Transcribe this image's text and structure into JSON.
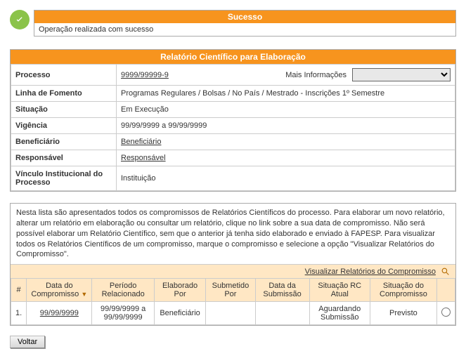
{
  "success": {
    "title": "Sucesso",
    "message": "Operação realizada com sucesso"
  },
  "report_panel": {
    "title": "Relatório Científico para Elaboração",
    "rows": {
      "processo_label": "Processo",
      "processo_value": "9999/99999-9",
      "mais_info_label": "Mais Informações",
      "linha_label": "Linha de Fomento",
      "linha_value": "Programas Regulares / Bolsas / No País / Mestrado - Inscrições 1º Semestre",
      "situacao_label": "Situação",
      "situacao_value": "Em Execução",
      "vigencia_label": "Vigência",
      "vigencia_value": "99/99/9999 a 99/99/9999",
      "beneficiario_label": "Beneficiário",
      "beneficiario_value": "Beneficiário",
      "responsavel_label": "Responsável",
      "responsavel_value": "Responsável",
      "vinculo_label": "Vínculo Institucional do Processo",
      "vinculo_value": "Instituição"
    }
  },
  "list": {
    "description": "Nesta lista são apresentados todos os compromissos de Relatórios Científicos do processo. Para elaborar um novo relatório, alterar um relatório em elaboração ou consultar um relatório, clique no link sobre a sua data de compromisso. Não será possível elaborar um Relatório Científico, sem que o anterior já tenha sido elaborado e enviado à FAPESP. Para visualizar todos os Relatórios Científicos de um compromisso, marque o compromisso e selecione a opção \"Visualizar Relatórios do Compromisso\".",
    "viz_link": "Visualizar Relatórios do Compromisso",
    "columns": {
      "num": "#",
      "data_compromisso": "Data do Compromisso",
      "periodo": "Período Relacionado",
      "elaborado": "Elaborado Por",
      "submetido": "Submetido Por",
      "data_submissao": "Data da Submissão",
      "situacao_rc": "Situação RC Atual",
      "situacao_comp": "Situação do Compromisso"
    },
    "rows": [
      {
        "num": "1.",
        "data_compromisso": "99/99/9999",
        "periodo": "99/99/9999 a 99/99/9999",
        "elaborado": "Beneficiário",
        "submetido": "",
        "data_submissao": "",
        "situacao_rc": "Aguardando Submissão",
        "situacao_comp": "Previsto"
      }
    ]
  },
  "buttons": {
    "voltar": "Voltar"
  }
}
